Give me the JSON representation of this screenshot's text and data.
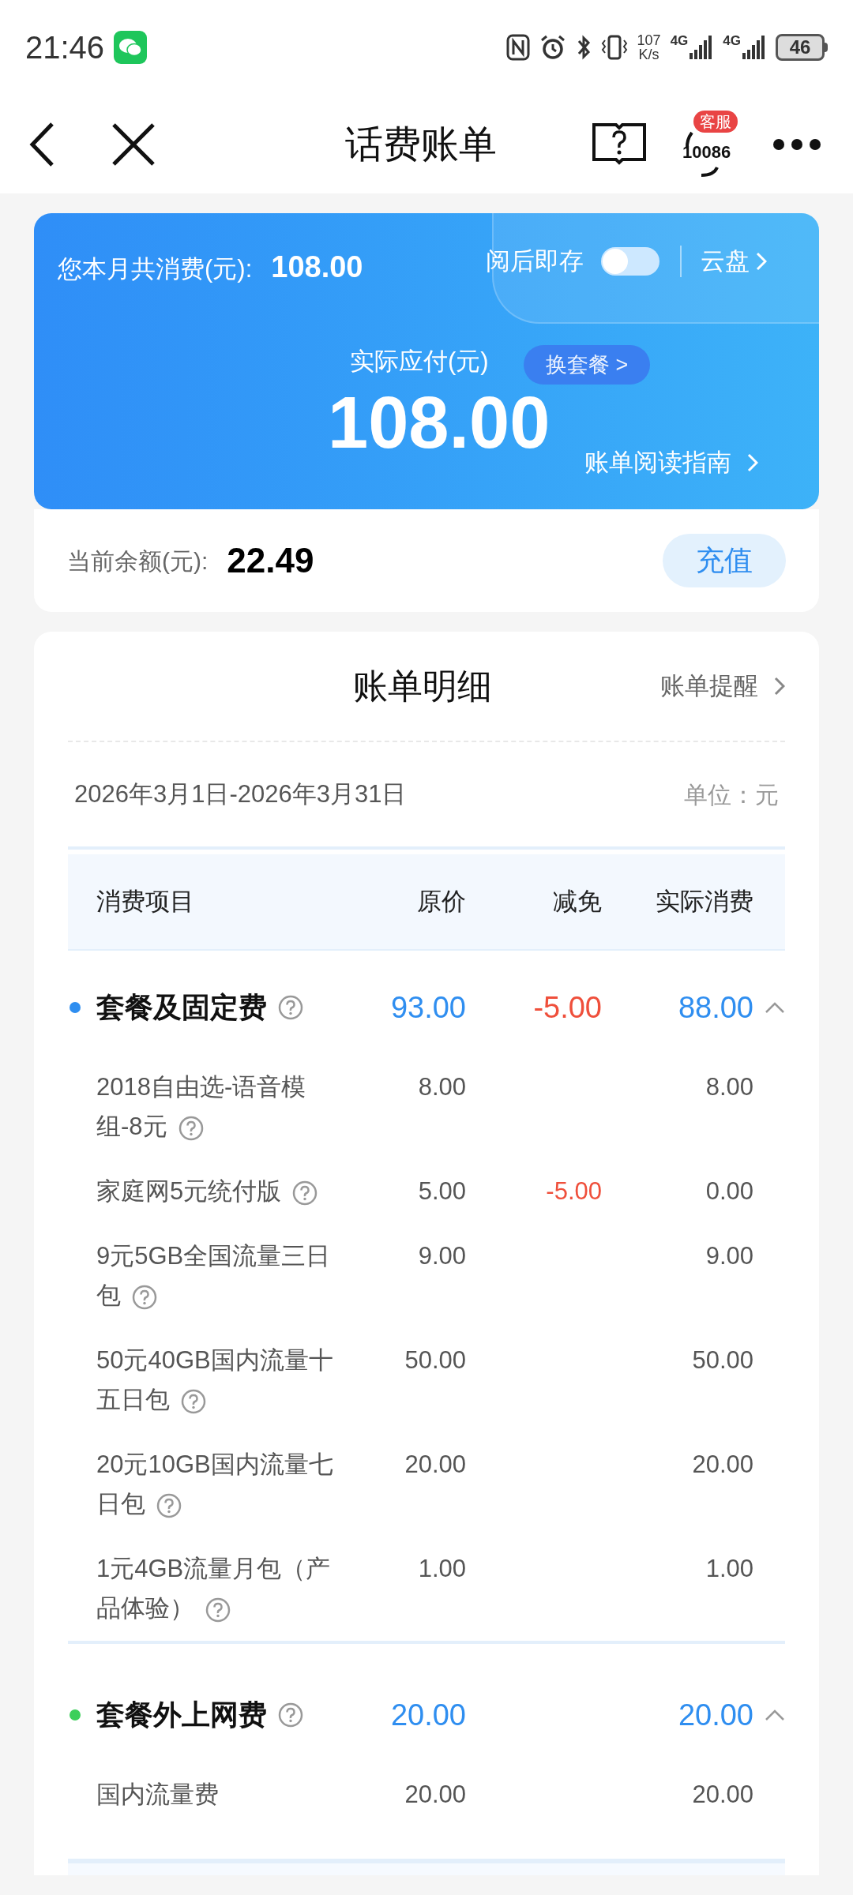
{
  "status_bar": {
    "time": "21:46",
    "speed": "107",
    "speed_unit": "K/s",
    "network_1": "4G",
    "network_2": "4G",
    "battery": "46"
  },
  "header": {
    "title": "话费账单",
    "service_badge": "客服",
    "service_number": "10086"
  },
  "summary": {
    "total_label": "您本月共消费(元):",
    "total": "108.00",
    "autosave_label": "阅后即存",
    "autosave_on": false,
    "cloud_link": "云盘",
    "payable_label": "实际应付(元)",
    "change_plan": "换套餐 >",
    "payable": "108.00",
    "guide_link": "账单阅读指南"
  },
  "balance": {
    "label": "当前余额(元):",
    "value": "22.49",
    "recharge": "充值"
  },
  "details": {
    "title": "账单明细",
    "reminder": "账单提醒",
    "period": "2026年3月1日-2026年3月31日",
    "unit": "单位：元",
    "columns": [
      "消费项目",
      "原价",
      "减免",
      "实际消费"
    ],
    "groups": [
      {
        "name": "套餐及固定费",
        "color": "#2f8ef0",
        "original": "93.00",
        "discount": "-5.00",
        "actual": "88.00",
        "expanded": true,
        "items": [
          {
            "name": "2018自由选-语音模组-8元",
            "help": true,
            "original": "8.00",
            "actual": "8.00"
          },
          {
            "name": "家庭网5元统付版",
            "help": true,
            "original": "5.00",
            "discount": "-5.00",
            "actual": "0.00"
          },
          {
            "name": "9元5GB全国流量三日包",
            "help": true,
            "original": "9.00",
            "actual": "9.00"
          },
          {
            "name": "50元40GB国内流量十五日包",
            "help": true,
            "original": "50.00",
            "actual": "50.00"
          },
          {
            "name": "20元10GB国内流量七日包",
            "help": true,
            "original": "20.00",
            "actual": "20.00"
          },
          {
            "name": "1元4GB流量月包（产品体验）",
            "help": true,
            "original": "1.00",
            "actual": "1.00"
          }
        ]
      },
      {
        "name": "套餐外上网费",
        "color": "#3ccf5a",
        "original": "20.00",
        "actual": "20.00",
        "expanded": true,
        "items": [
          {
            "name": "国内流量费",
            "help": false,
            "original": "20.00",
            "actual": "20.00"
          }
        ]
      }
    ]
  }
}
